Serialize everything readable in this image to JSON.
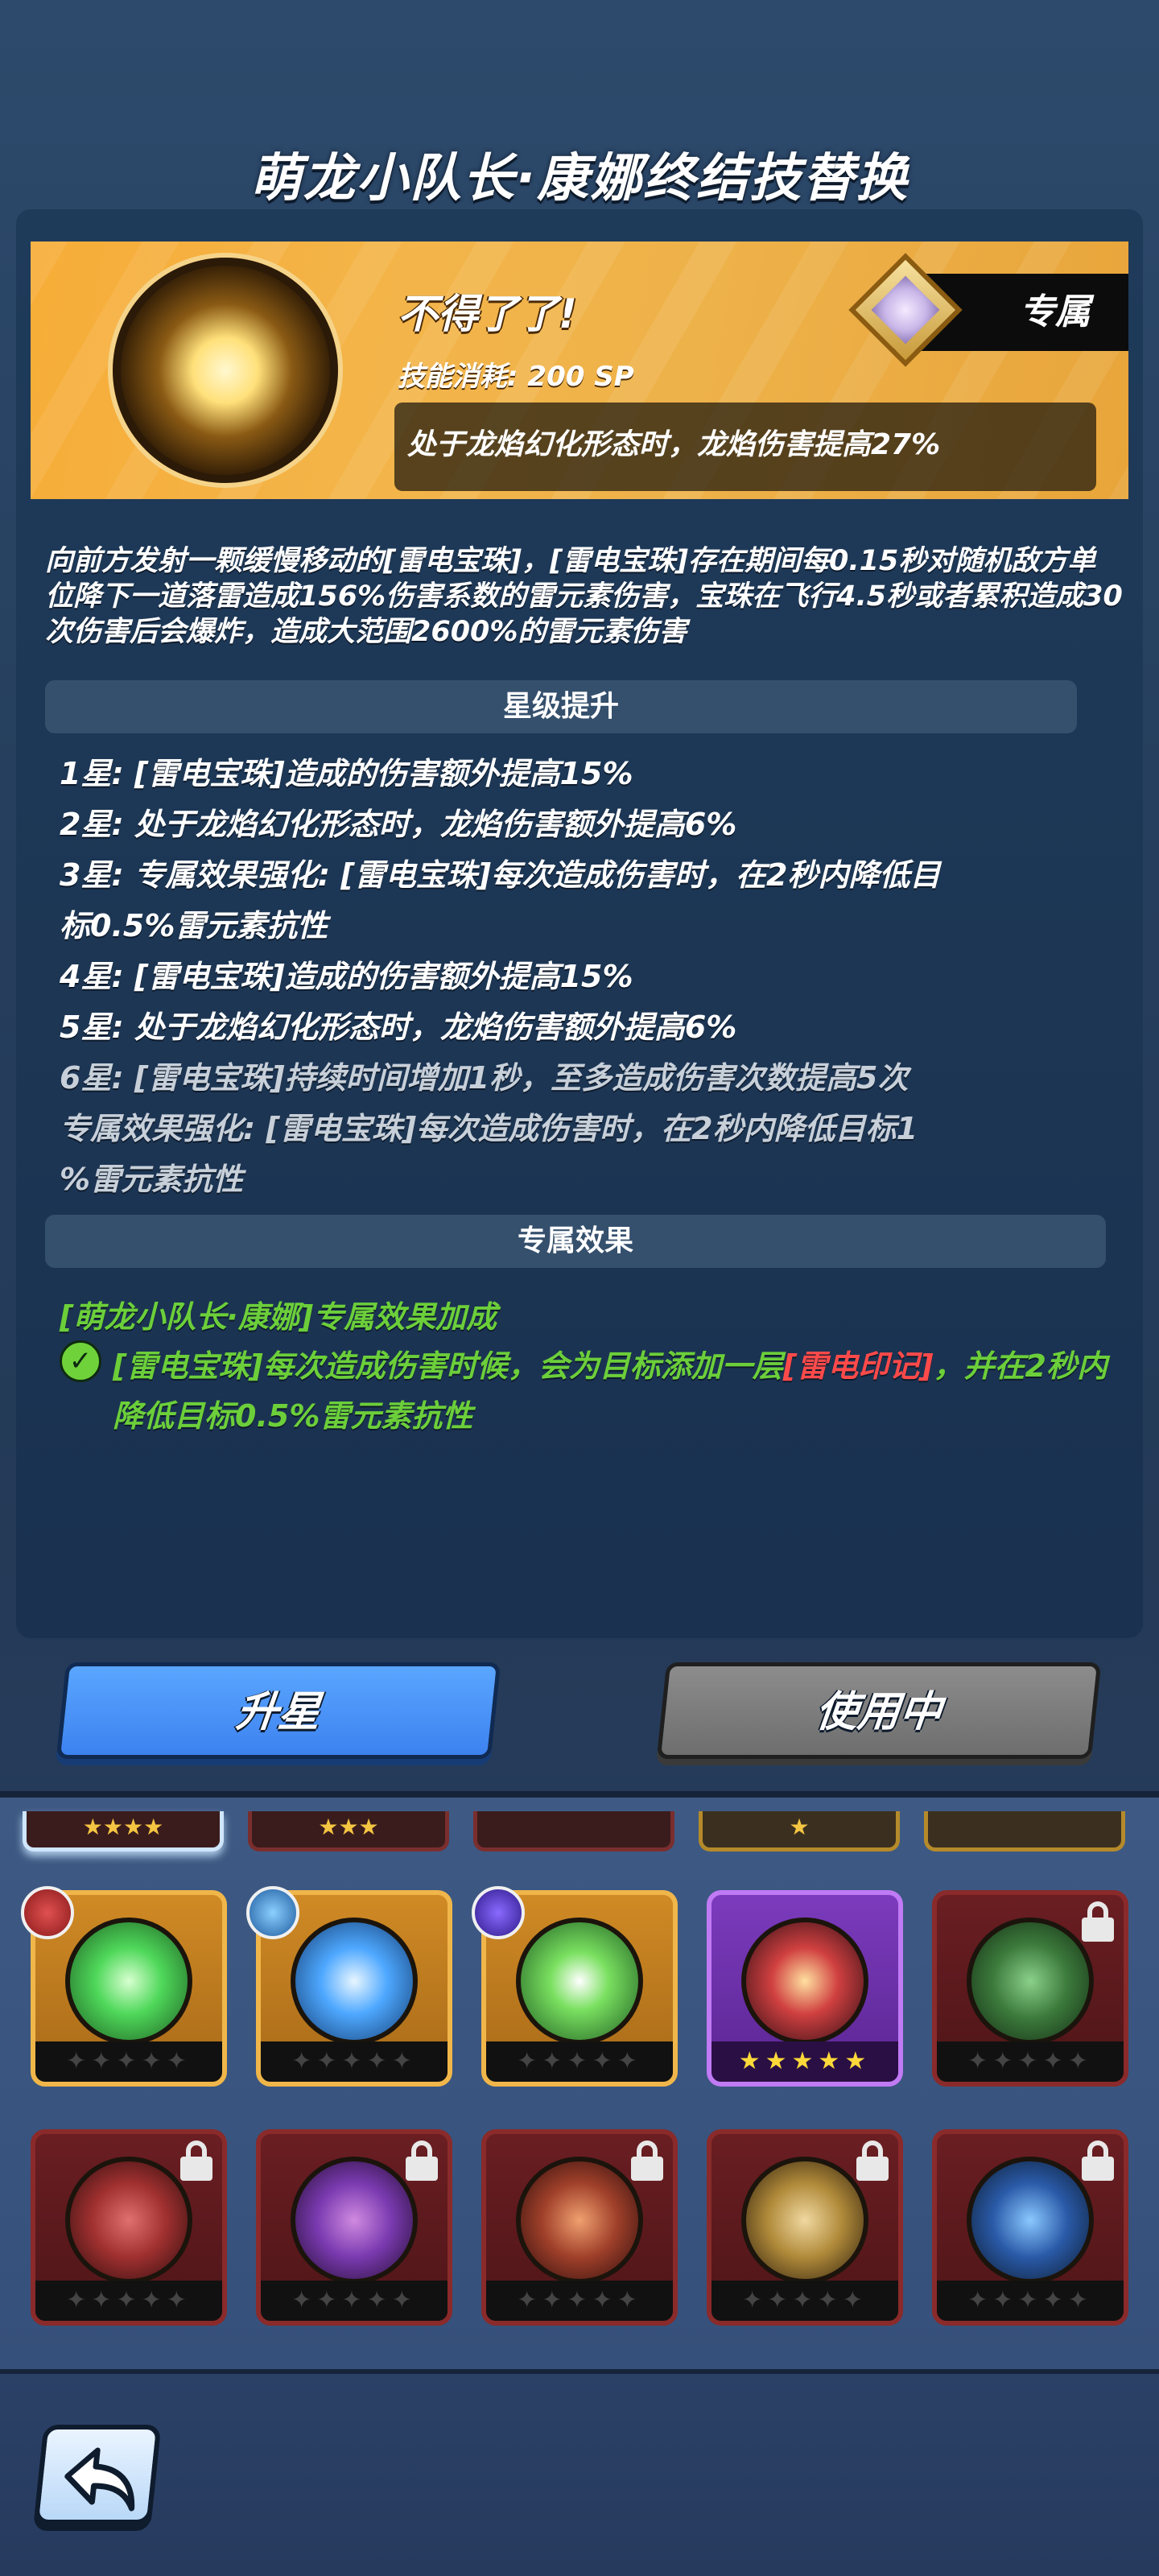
{
  "title": "萌龙小队长·康娜终结技替换",
  "skill": {
    "name": "不得了了!",
    "cost": "技能消耗: 200 SP",
    "bonus": "处于龙焰幻化形态时，龙焰伤害提高27%",
    "exclusive_tag": "专属"
  },
  "description": "向前方发射一颗缓慢移动的[雷电宝珠]，[雷电宝珠]存在期间每0.15秒对随机敌方单位降下一道落雷造成156%伤害系数的雷元素伤害，宝珠在飞行4.5秒或者累积造成30次伤害后会爆炸，造成大范围2600%的雷元素伤害",
  "star_section": {
    "header": "星级提升",
    "lines": [
      "1星: [雷电宝珠]造成的伤害额外提高15%",
      "2星: 处于龙焰幻化形态时，龙焰伤害额外提高6%",
      "3星: 专属效果强化: [雷电宝珠]每次造成伤害时，在2秒内降低目",
      "标0.5%雷元素抗性",
      "4星: [雷电宝珠]造成的伤害额外提高15%",
      "5星: 处于龙焰幻化形态时，龙焰伤害额外提高6%",
      "6星: [雷电宝珠]持续时间增加1秒，至多造成伤害次数提高5次",
      "专属效果强化: [雷电宝珠]每次造成伤害时，在2秒内降低目标1",
      "%雷元素抗性"
    ]
  },
  "exclusive_section": {
    "header": "专属效果",
    "title": "[萌龙小队长·康娜]专属效果加成",
    "text_before": "[雷电宝珠]每次造成伤害时候，会为目标添加一层",
    "text_red": "[雷电印记]",
    "text_after": "，并在2秒内降低目标0.5%雷元素抗性"
  },
  "buttons": {
    "upgrade": "升星",
    "in_use": "使用中"
  },
  "partial_stars": [
    "★★★★",
    "★★★",
    "",
    "★",
    ""
  ],
  "cards_row1": [
    {
      "style": "gold",
      "stars": "✦✦✦✦✦",
      "orb_color": "#4fd85a",
      "badge": "#c0392b"
    },
    {
      "style": "gold",
      "stars": "✦✦✦✦✦",
      "orb_color": "#4ea8ff",
      "badge": "#2f7fd0"
    },
    {
      "style": "gold",
      "stars": "✦✦✦✦✦",
      "orb_color": "#4fd85a",
      "badge": "#5e3bd0"
    },
    {
      "style": "purple",
      "stars": "★★★★★",
      "orb_color": "#d04040",
      "badge": ""
    },
    {
      "style": "red",
      "stars": "✦✦✦✦✦",
      "orb_color": "#3c7a3c",
      "badge": "",
      "locked": true
    }
  ],
  "cards_row2": [
    {
      "style": "red",
      "stars": "✦✦✦✦✦",
      "orb_color": "#a03030",
      "locked": true
    },
    {
      "style": "red",
      "stars": "✦✦✦✦✦",
      "orb_color": "#7a3ab0",
      "locked": true
    },
    {
      "style": "red",
      "stars": "✦✦✦✦✦",
      "orb_color": "#a0402a",
      "locked": true
    },
    {
      "style": "red",
      "stars": "✦✦✦✦✦",
      "orb_color": "#b08a3a",
      "locked": true
    },
    {
      "style": "red",
      "stars": "✦✦✦✦✦",
      "orb_color": "#2a5aa8",
      "locked": true
    }
  ]
}
